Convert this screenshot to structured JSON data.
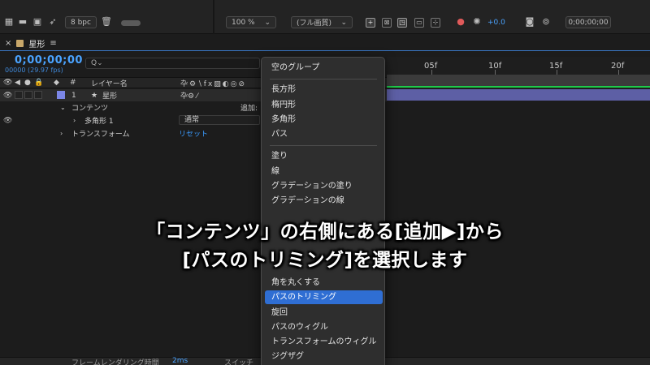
{
  "toolbar": {
    "bpc": "8 bpc",
    "zoom": "100 %",
    "quality": "(フル画質)",
    "exposure": "+0.0",
    "time": "0;00;00;00"
  },
  "panel": {
    "close": "×",
    "title": "星形",
    "menu_icon": "≡"
  },
  "timeline": {
    "timecode": "0;00;00;00",
    "fps": "00000 (29.97 fps)",
    "search_placeholder": "Q⌄",
    "ruler_labels": [
      "05f",
      "10f",
      "15f",
      "20f"
    ],
    "column_layer_name": "レイヤー名",
    "column_number": "#"
  },
  "layers": {
    "layer1_number": "1",
    "layer1_name": "星形",
    "contents": "コンテンツ",
    "add_label": "追加:",
    "polygon": "多角形 1",
    "blend_mode": "通常",
    "transform": "トランスフォーム",
    "reset": "リセット"
  },
  "menu": {
    "group1": [
      "空のグループ"
    ],
    "group2": [
      "長方形",
      "楕円形",
      "多角形",
      "パス"
    ],
    "group3": [
      "塗り",
      "線",
      "グラデーションの塗り",
      "グラデーションの線"
    ],
    "group4": [
      "角を丸くする",
      "パスのトリミング",
      "旋回",
      "パスのウィグル",
      "トランスフォームのウィグル",
      "ジグザグ"
    ],
    "active_item": "パスのトリミング"
  },
  "bottom": {
    "render_time_label": "フレームレンダリング時間",
    "render_time_value": "2ms",
    "switch_label": "スイッチ"
  },
  "caption": {
    "line1": "「コンテンツ」の右側にある[追加▶]から",
    "line2": "[パスのトリミング]を選択します"
  },
  "colors": {
    "accent_blue": "#4aa3ff",
    "menu_highlight": "#2f6ed3",
    "layer_bar": "#5d5fa5",
    "layer_label": "#7b86e6",
    "work_area_green": "#1ec94a"
  }
}
